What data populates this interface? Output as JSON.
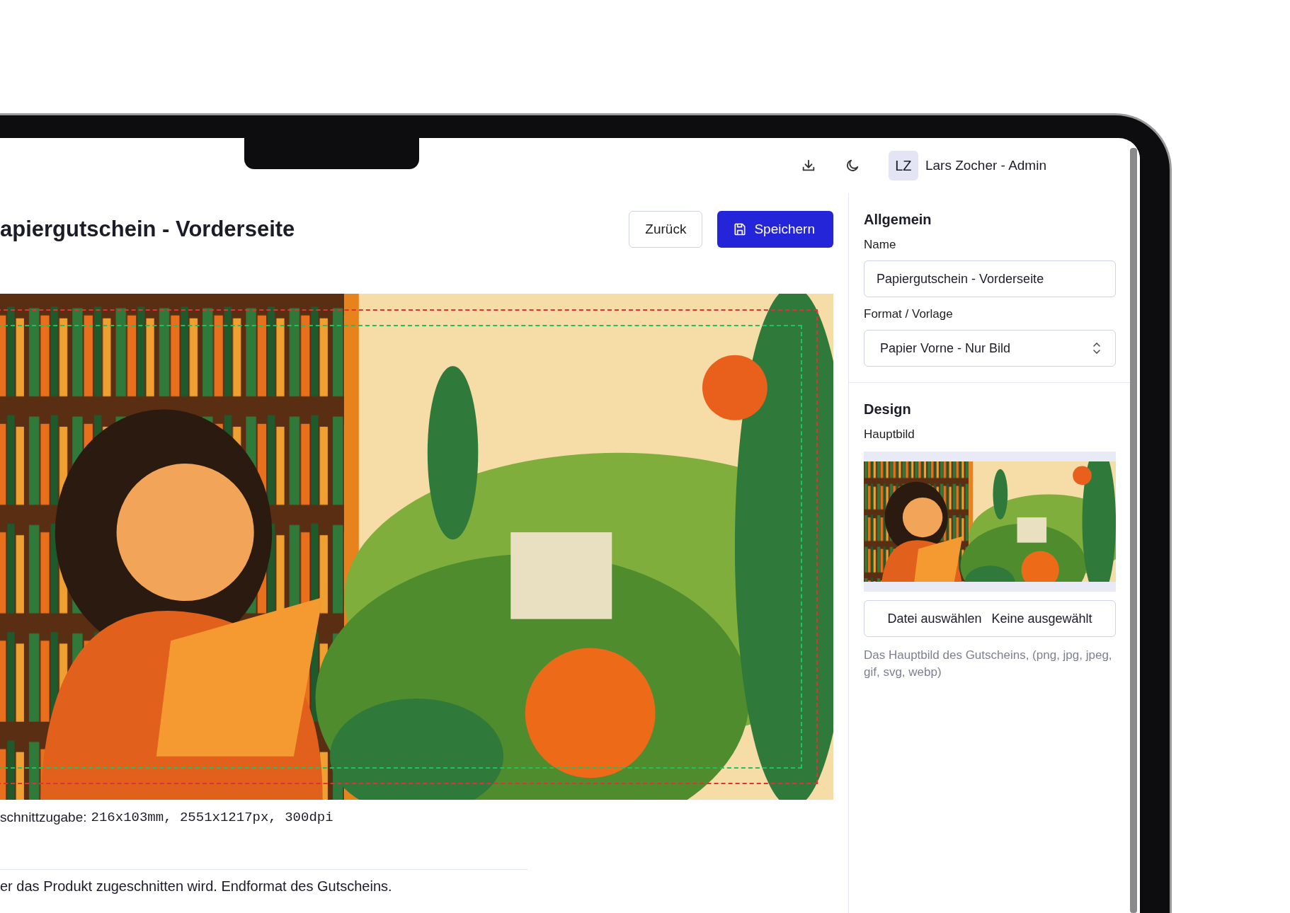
{
  "header": {
    "avatar_initials": "LZ",
    "user_name": "Lars Zocher - Admin"
  },
  "page": {
    "title": "apiergutschein - Vorderseite",
    "buttons": [
      {
        "label": "Zurück",
        "kind": "secondary"
      },
      {
        "label": "Speichern",
        "kind": "primary"
      }
    ]
  },
  "preview": {
    "kind": "picture",
    "size_label": "schnittzugabe:",
    "size_value": "216x103mm, 2551x1217px, 300dpi",
    "note": "er das Produkt zugeschnitten wird. Endformat des Gutscheins."
  },
  "sidebar": {
    "sections": [
      {
        "title": "Allgemein",
        "fields": [
          {
            "kind": "text",
            "label": "Name",
            "value": "Papiergutschein - Vorderseite"
          },
          {
            "kind": "select",
            "label": "Format / Vorlage",
            "value": "Papier Vorne - Nur Bild"
          }
        ]
      },
      {
        "title": "Design",
        "fields": [
          {
            "label": "Hauptbild",
            "button": "Datei auswählen",
            "file_status": "Keine ausgewählt",
            "help": "Das Hauptbild des Gutscheins, (png, jpg, jpeg, gif, svg, webp)"
          }
        ]
      }
    ]
  }
}
